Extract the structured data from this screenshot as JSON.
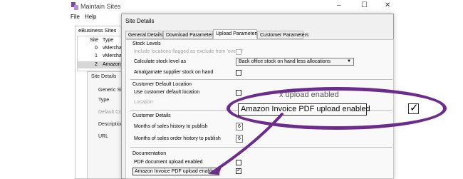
{
  "colors": {
    "accent": "#6b2c8a"
  },
  "background_window": {
    "title": "Maintain Sites",
    "controls": [
      "–",
      "☐",
      "✕"
    ],
    "menu": [
      "File",
      "Help"
    ],
    "group_title": "eBusiness Sites",
    "columns": [
      "Site",
      "Type"
    ],
    "rows": [
      {
        "site": "0",
        "type": "vMerchan"
      },
      {
        "site": "1",
        "type": "vMerchan"
      },
      {
        "site": "2",
        "type": "Amazon"
      }
    ],
    "detail_title": "Site Details",
    "fields": [
      "Generic Sit",
      "Type",
      "Default Co",
      "Description",
      "URL"
    ]
  },
  "dialog": {
    "title": "Site Details",
    "tabs": [
      "General Details",
      "Download Parameters",
      "Upload Parameters",
      "Customer Parameters"
    ],
    "active_tab": "Upload Parameters",
    "stock_levels": {
      "title": "Stock Levels",
      "include_excluded_label": "Include locations flagged as exclude from 'overall'",
      "calculate_label": "Calculate stock level as",
      "calculate_value": "Back office stock on hand less allocations",
      "amalgamate_label": "Amalgamate supplier stock on hand"
    },
    "customer_default_location": {
      "title": "Customer Default Location",
      "use_default_label": "Use customer default location",
      "location_label": "Location"
    },
    "customer_details": {
      "title": "Customer Details",
      "months_sales_label": "Months of sales history to publish",
      "months_sales_value": "6",
      "months_orders_label": "Months of sales order history to publish",
      "months_orders_value": "6"
    },
    "documentation": {
      "title": "Documentation",
      "pdf_doc_label": "PDF document upload enabled",
      "amazon_invoice_label": "Amazon Invoice PDF upload enabled",
      "amazon_invoice_checked": true
    }
  },
  "callout": {
    "label": "Amazon Invoice PDF upload enabled",
    "ghost_text": "x upload enabled",
    "checked_glyph": "✓"
  }
}
